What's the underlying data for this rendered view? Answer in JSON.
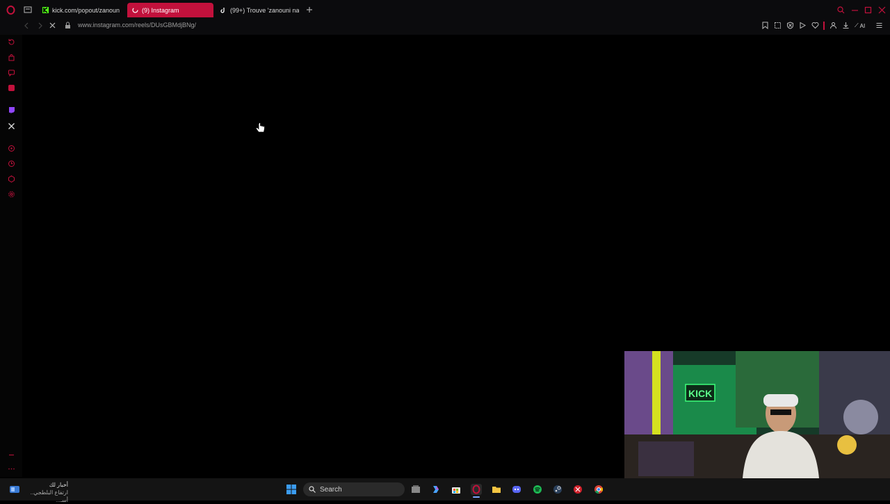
{
  "browser": {
    "tabs": [
      {
        "label": "kick.com/popout/zanouni",
        "favicon": "kick-icon",
        "active": false
      },
      {
        "label": "(9) Instagram",
        "favicon": "loading-spinner-icon",
        "active": true
      },
      {
        "label": "(99+) Trouve 'zanouni nat",
        "favicon": "tiktok-icon",
        "active": false
      }
    ],
    "url": "www.instagram.com/reels/DUsGBMdjBNg/",
    "ai_label": "AI",
    "accent": "#c2113c"
  },
  "sidebar": {
    "items": [
      "history-icon",
      "bag-icon",
      "chat-icon",
      "messenger-icon",
      "twitch-icon",
      "x-icon",
      "music-icon",
      "clock-icon",
      "box-icon",
      "settings-icon"
    ]
  },
  "taskbar": {
    "search_placeholder": "Search",
    "news_title": "أخبار لك",
    "news_text": "ارتفاع البلطجي.. أسـ..."
  }
}
